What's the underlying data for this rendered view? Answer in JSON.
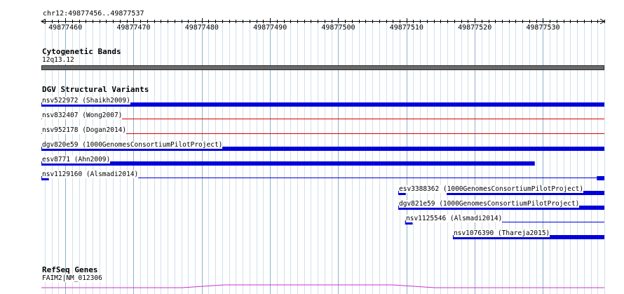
{
  "browser": {
    "location": "chr12:49877456..49877537",
    "region": {
      "start": 49877456.5,
      "end": 49877539
    },
    "ruler_ticks": [
      "49877460",
      "49877470",
      "49877480",
      "49877490",
      "49877500",
      "49877510",
      "49877520",
      "49877530"
    ],
    "colors": {
      "grid_major": "#8cb2cc",
      "grid_minor": "#cfe0ec",
      "variant": "#0000dd",
      "refseq": "#cc33cc",
      "band": "#6a6a6a"
    }
  },
  "tracks": {
    "cytoband": {
      "title": "Cytogenetic Bands",
      "band_label": "12q13.12"
    },
    "dgv": {
      "title": "DGV Structural Variants",
      "features": [
        {
          "label": "nsv522972 (Shaikh2009)",
          "style": "thick",
          "blocks": [
            [
              49877456.5,
              49877539
            ]
          ]
        },
        {
          "label": "nsv832407 (Wong2007)",
          "style": "thin",
          "color": "#dd0000",
          "blocks": [
            [
              49877456.5,
              49877539
            ]
          ]
        },
        {
          "label": "nsv952178 (Dogan2014)",
          "style": "thin",
          "color": "#dd0000",
          "blocks": [
            [
              49877456.5,
              49877539
            ]
          ]
        },
        {
          "label": "dgv820e59 (1000GenomesConsortiumPilotProject)",
          "style": "thick",
          "blocks": [
            [
              49877456.5,
              49877539
            ]
          ]
        },
        {
          "label": "esv8771 (Ahn2009)",
          "style": "thick",
          "blocks": [
            [
              49877456.5,
              49877528.8
            ]
          ]
        },
        {
          "label": "nsv1129160 (Alsmadi2014)",
          "style": "gapped",
          "span": [
            49877456.5,
            49877539
          ],
          "blocks": [
            [
              49877456.5,
              49877457.6
            ],
            [
              49877537.9,
              49877539
            ]
          ]
        },
        {
          "label": "esv3388362 (1000GenomesConsortiumPilotProject)",
          "style": "gapped",
          "span": [
            49877508.8,
            49877539
          ],
          "blocks": [
            [
              49877508.8,
              49877509.9
            ],
            [
              49877515.9,
              49877539
            ]
          ]
        },
        {
          "label": "dgv821e59 (1000GenomesConsortiumPilotProject)",
          "style": "thick",
          "blocks": [
            [
              49877508.8,
              49877539
            ]
          ]
        },
        {
          "label": "nsv1125546 (Alsmadi2014)",
          "style": "gapped",
          "span": [
            49877509.8,
            49877539
          ],
          "blocks": [
            [
              49877509.8,
              49877510.9
            ]
          ]
        },
        {
          "label": "nsv1076390 (Thareja2015)",
          "style": "thick",
          "blocks": [
            [
              49877516.8,
              49877539
            ]
          ]
        }
      ]
    },
    "refseq": {
      "title": "RefSeq Genes",
      "gene_label": "FAIM2|NM_012306"
    }
  }
}
